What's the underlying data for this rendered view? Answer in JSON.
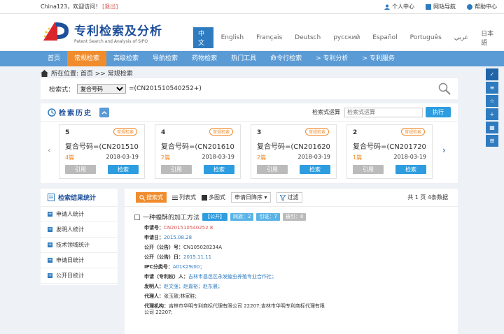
{
  "topbar": {
    "welcome": "China123，欢迎访问！",
    "logout": "[退出]",
    "links": [
      "个人中心",
      "网站导航",
      "帮助中心"
    ]
  },
  "logo": {
    "title": "专利检索及分析",
    "subtitle": "Patent Search and Analysis of SIPO"
  },
  "languages": [
    "中文",
    "English",
    "Français",
    "Deutsch",
    "русский",
    "Español",
    "Português",
    "عربي",
    "日本語"
  ],
  "nav": [
    "首页",
    "常规检索",
    "高级检索",
    "导航检索",
    "药物检索",
    "热门工具",
    "命令行检索",
    "> 专利分析",
    "> 专利服务"
  ],
  "breadcrumb": "所在位置: 首页 >> 常规检索",
  "search": {
    "label": "检索式：",
    "field": "复合号码",
    "expr": "=(CN201510540252+)"
  },
  "history": {
    "title": "检索历史",
    "rule_label": "检索式运算",
    "rule_placeholder": "检索式运算",
    "exec": "执行",
    "cards": [
      {
        "num": "5",
        "tag": "常规检索",
        "query": "复合号码=(CN201510540252+)",
        "count": "4篇",
        "date": "2018-03-19",
        "cite": "引用",
        "go": "检索"
      },
      {
        "num": "4",
        "tag": "常规检索",
        "query": "复合号码=(CN201610150000+)",
        "count": "2篇",
        "date": "2018-03-19",
        "cite": "引用",
        "go": "检索"
      },
      {
        "num": "3",
        "tag": "常规检索",
        "query": "复合号码=(CN201620210000+)",
        "count": "2篇",
        "date": "2018-03-19",
        "cite": "引用",
        "go": "检索"
      },
      {
        "num": "2",
        "tag": "常规检索",
        "query": "复合号码=(CN201720890000+)",
        "count": "1篇",
        "date": "2018-03-19",
        "cite": "引用",
        "go": "检索"
      }
    ]
  },
  "stats": {
    "title": "检索结果统计",
    "items": [
      "申请人统计",
      "发明人统计",
      "技术领域统计",
      "申请日统计",
      "公开日统计"
    ]
  },
  "toolbar": {
    "search_view": "搜索式",
    "list_view": "列表式",
    "image_view": "多图式",
    "sort": "申请日降序",
    "filter": "过滤",
    "pages": "共 1 页 4条数据"
  },
  "record": {
    "title": "一种蝗酥的加工方法",
    "chip_pub": "【公开】",
    "chip_fam": "同族：2",
    "chip_cite": "引证：7",
    "chip_cited": "被引：0",
    "app_no_label": "申请号：",
    "app_no": "CN201510540252.8",
    "app_date_label": "申请日：",
    "app_date": "2015.08.28",
    "pub_no_label": "公开（公告）号：",
    "pub_no": "CN105028234A",
    "pub_date_label": "公开（公告）日：",
    "pub_date": "2015.11.11",
    "ipc_label": "IPC分类号：",
    "ipc": "A01K29/00；",
    "applicant_label": "申请（专利权）人：",
    "applicant": "吉林市昌邑区永发蝗虫养殖专业合作社；",
    "inventor_label": "发明人：",
    "inventor": "赵文强；赵嘉裕；赵东晨；",
    "agent_label": "代理人：",
    "agent": "张玉致;林家胜;",
    "agency_label": "代理机构：",
    "agency": "吉林市华明专利商标代理有限公司 22207;吉林市华明专利商标代理有限公司 22207;"
  },
  "colors": {
    "primary": "#2e7bbf",
    "accent": "#f08c2c",
    "nav": "#5b9bd5"
  }
}
